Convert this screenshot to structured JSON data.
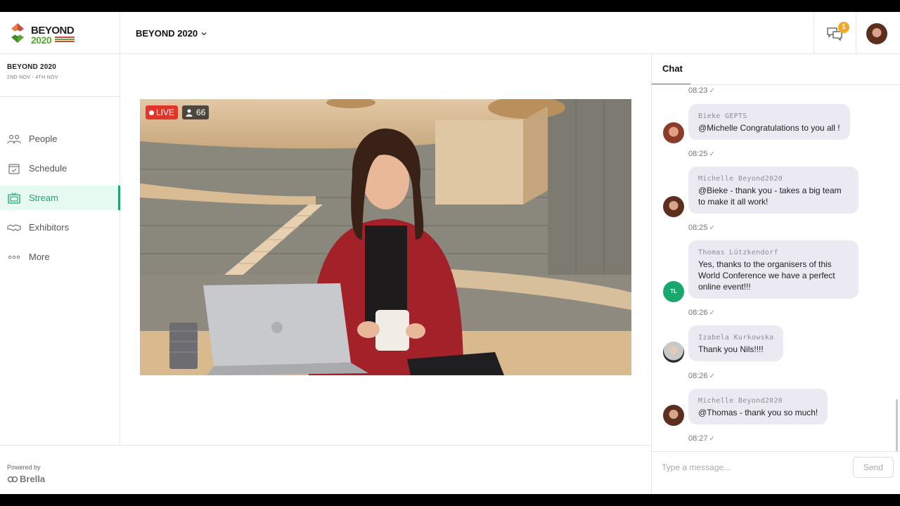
{
  "header": {
    "logo_line1": "BEYOND",
    "logo_line2": "2020",
    "event_dropdown_label": "BEYOND 2020",
    "notification_count": "1"
  },
  "sidebar": {
    "event_name": "BEYOND 2020",
    "event_dates": "2ND NOV - 4TH NOV",
    "items": [
      {
        "label": "People",
        "icon": "people-icon"
      },
      {
        "label": "Schedule",
        "icon": "calendar-icon"
      },
      {
        "label": "Stream",
        "icon": "tv-icon",
        "active": true
      },
      {
        "label": "Exhibitors",
        "icon": "handshake-icon"
      },
      {
        "label": "More",
        "icon": "more-dots-icon"
      }
    ],
    "powered_by": "Powered by",
    "brand": "Brella"
  },
  "stream": {
    "live_label": "LIVE",
    "viewer_count": "66"
  },
  "chat": {
    "tab_label": "Chat",
    "first_time": "08:23",
    "messages": [
      {
        "sender": "Bieke GEPTS",
        "text": "@Michelle Congratulations to you all !",
        "time": "08:25"
      },
      {
        "sender": "Michelle Beyond2020",
        "text": "@Bieke - thank you - takes a big team to make it all work!",
        "time": "08:25"
      },
      {
        "sender": "Thomas Lützkendorf",
        "text": "Yes, thanks to the organisers of this World Conference we have a perfect online event!!!",
        "time": "08:26",
        "initials": "TL"
      },
      {
        "sender": "Izabela Kurkowska",
        "text": "Thank you Nils!!!!",
        "time": "08:26"
      },
      {
        "sender": "Michelle Beyond2020",
        "text": "@Thomas - thank you so much!",
        "time": "08:27"
      }
    ],
    "input_placeholder": "Type a message...",
    "send_label": "Send"
  },
  "colors": {
    "accent": "#18a86e",
    "live": "#e0352b",
    "badge": "#f5a623",
    "bubble": "#ebeaf3"
  }
}
